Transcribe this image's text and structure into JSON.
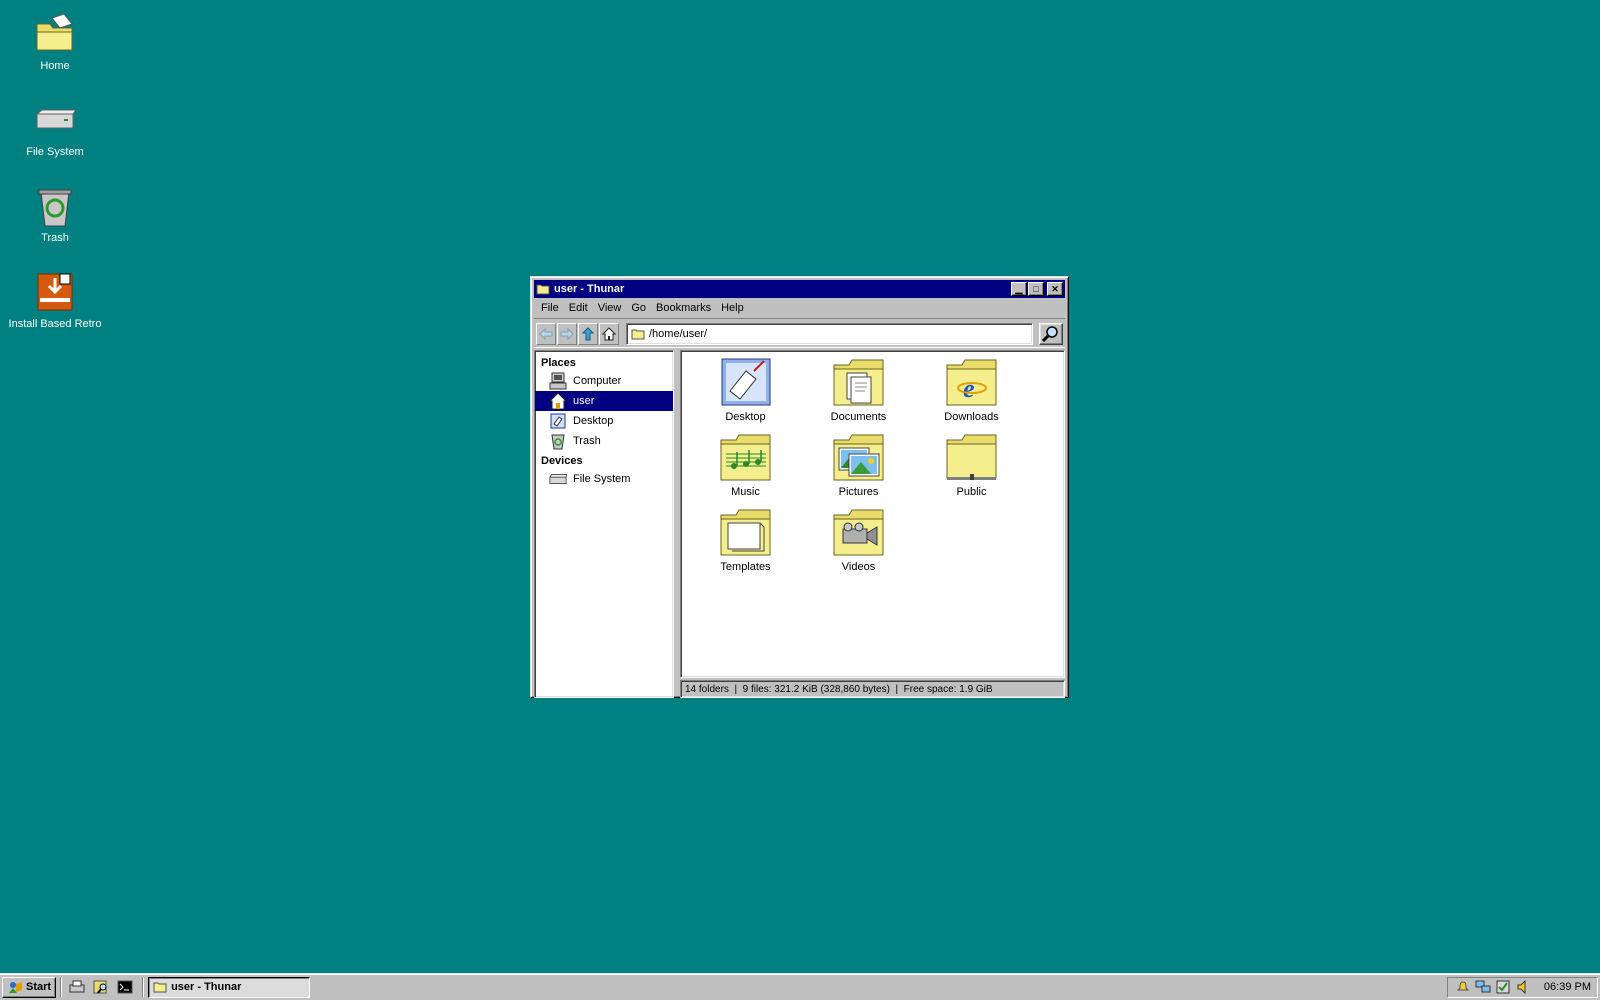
{
  "desktop": {
    "icons": [
      {
        "label": "Home",
        "icon": "home-folder-icon"
      },
      {
        "label": "File System",
        "icon": "drive-icon"
      },
      {
        "label": "Trash",
        "icon": "trash-icon"
      },
      {
        "label": "Install Based Retro",
        "icon": "installer-icon"
      }
    ]
  },
  "window": {
    "title": "user - Thunar",
    "menu": [
      "File",
      "Edit",
      "View",
      "Go",
      "Bookmarks",
      "Help"
    ],
    "location": "/home/user/",
    "sidebar": {
      "places_header": "Places",
      "places": [
        {
          "label": "Computer",
          "icon": "computer-icon",
          "selected": false
        },
        {
          "label": "user",
          "icon": "home-icon",
          "selected": true
        },
        {
          "label": "Desktop",
          "icon": "desktop-icon",
          "selected": false
        },
        {
          "label": "Trash",
          "icon": "trash-icon",
          "selected": false
        }
      ],
      "devices_header": "Devices",
      "devices": [
        {
          "label": "File System",
          "icon": "drive-icon"
        }
      ]
    },
    "files": [
      {
        "label": "Desktop",
        "icon": "desktop-icon"
      },
      {
        "label": "Documents",
        "icon": "documents-folder-icon"
      },
      {
        "label": "Downloads",
        "icon": "downloads-folder-icon"
      },
      {
        "label": "Music",
        "icon": "music-folder-icon"
      },
      {
        "label": "Pictures",
        "icon": "pictures-folder-icon"
      },
      {
        "label": "Public",
        "icon": "public-folder-icon"
      },
      {
        "label": "Templates",
        "icon": "templates-folder-icon"
      },
      {
        "label": "Videos",
        "icon": "videos-folder-icon"
      }
    ],
    "status": "14 folders  |  9 files: 321.2 KiB (328,860 bytes)  |  Free space: 1.9 GiB"
  },
  "taskbar": {
    "start_label": "Start",
    "task_label": "user - Thunar",
    "clock": "06:39 PM"
  },
  "colors": {
    "desktop": "#008080",
    "titlebar": "#000080",
    "face": "#c0c0c0",
    "folder": "#f4ee8c"
  }
}
